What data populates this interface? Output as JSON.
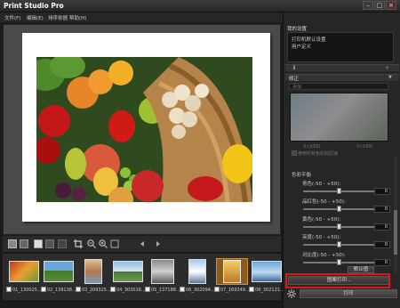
{
  "window": {
    "title": "Print Studio Pro"
  },
  "menu": [
    "文件(F)",
    "编辑(E)",
    "排序依据",
    "帮助(H)"
  ],
  "panel": {
    "my_settings_title": "我的设置",
    "settings_items": [
      "打印机默认设置",
      "用户定义"
    ],
    "info_icon": "i",
    "correction_title": "修正",
    "dropdown_value": "添加",
    "coords": {
      "x": "X:(±50)",
      "y": "Y:(±50)"
    },
    "checkbox_label": "使用所有色彩的区域",
    "color_balance_title": "色彩平衡",
    "sliders": [
      {
        "label": "青色(-50 - +50):",
        "value": 0
      },
      {
        "label": "品红色(-50 - +50):",
        "value": 0
      },
      {
        "label": "黄色(-50 - +50):",
        "value": 0
      },
      {
        "label": "亮度(-50 - +50):",
        "value": 0
      },
      {
        "label": "对比度(-50 - +50):",
        "value": 0
      }
    ],
    "default_button": "默认值",
    "preview_print_button": "图案打印...",
    "print_button": "打印"
  },
  "thumbnails": [
    {
      "label": "01_130025..."
    },
    {
      "label": "02_139138..."
    },
    {
      "label": "03_209325..."
    },
    {
      "label": "04_303016..."
    },
    {
      "label": "05_137188..."
    },
    {
      "label": "06_302094..."
    },
    {
      "label": "07_169349..."
    },
    {
      "label": "08_302121..."
    }
  ],
  "icons": {
    "fit": "fit-page-icon",
    "crop": "crop-icon",
    "zoom_out": "zoom-out-icon",
    "zoom_in": "zoom-in-icon",
    "prev": "prev-page-icon",
    "next": "next-page-icon",
    "settings": "gear-icon"
  }
}
